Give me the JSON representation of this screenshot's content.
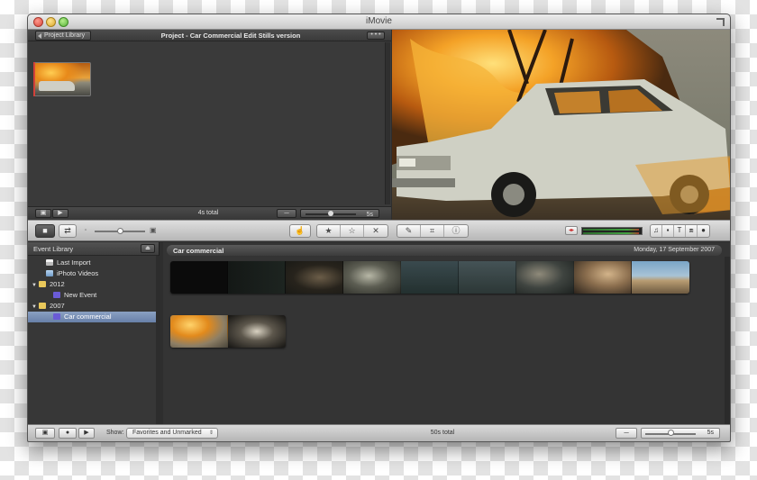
{
  "window": {
    "title": "iMovie"
  },
  "project": {
    "back_label": "Project Library",
    "title": "Project - Car Commercial Edit Stills version",
    "more_label": "• • •",
    "total": "4s total",
    "zoom_label": "5s",
    "zoom_fraction": 0.5
  },
  "toolbar": {
    "icons": [
      "camera-import-icon",
      "swap-icon",
      "thumbnail-small-icon",
      "thumbnail-size-slider",
      "thumbnail-large-icon",
      "hand-add-icon",
      "favorite-star-icon",
      "unmark-star-icon",
      "reject-x-icon",
      "eyedropper-icon",
      "crop-icon",
      "info-icon",
      "audio-toggle-icon",
      "music-icon",
      "photo-icon",
      "title-icon",
      "transition-icon",
      "map-icon"
    ],
    "thumbnail_slider_fraction": 0.5
  },
  "event_library": {
    "title": "Event Library",
    "items": [
      {
        "label": "Last Import",
        "icon": "clapper-icon",
        "indent": 1,
        "tri": ""
      },
      {
        "label": "iPhoto Videos",
        "icon": "iphoto-icon",
        "indent": 1,
        "tri": ""
      },
      {
        "label": "2012",
        "icon": "folder-icon",
        "indent": 0,
        "tri": "▼"
      },
      {
        "label": "New Event",
        "icon": "event-star-icon",
        "indent": 2,
        "tri": ""
      },
      {
        "label": "2007",
        "icon": "folder-icon",
        "indent": 0,
        "tri": "▼"
      },
      {
        "label": "Car commercial",
        "icon": "event-star-icon",
        "indent": 2,
        "tri": "",
        "selected": true
      }
    ]
  },
  "event_browser": {
    "event_name": "Car commercial",
    "event_date": "Monday, 17 September 2007"
  },
  "bottom_bar": {
    "show_label": "Show:",
    "show_value": "Favorites and Unmarked",
    "total": "50s total",
    "zoom_label": "5s",
    "zoom_fraction": 0.5
  }
}
